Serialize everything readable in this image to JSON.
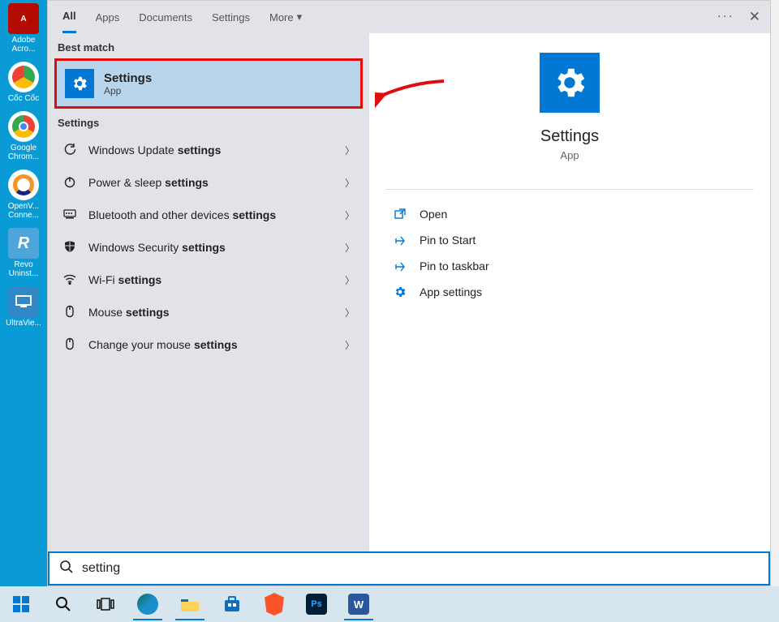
{
  "tabs": {
    "all": "All",
    "apps": "Apps",
    "documents": "Documents",
    "settings": "Settings",
    "more": "More"
  },
  "sections": {
    "best_match": "Best match",
    "settings": "Settings"
  },
  "best_match": {
    "title": "Settings",
    "subtitle": "App"
  },
  "settings_list": [
    {
      "icon": "refresh",
      "text_pre": "Windows Update ",
      "text_bold": "settings"
    },
    {
      "icon": "power",
      "text_pre": "Power & sleep ",
      "text_bold": "settings"
    },
    {
      "icon": "bt",
      "text_pre": "Bluetooth and other devices ",
      "text_bold": "settings"
    },
    {
      "icon": "shield",
      "text_pre": "Windows Security ",
      "text_bold": "settings"
    },
    {
      "icon": "wifi",
      "text_pre": "Wi-Fi ",
      "text_bold": "settings"
    },
    {
      "icon": "mouse",
      "text_pre": "Mouse ",
      "text_bold": "settings"
    },
    {
      "icon": "mouse",
      "text_pre": "Change your mouse ",
      "text_bold": "settings"
    }
  ],
  "preview": {
    "title": "Settings",
    "subtitle": "App"
  },
  "actions": {
    "open": "Open",
    "pin_start": "Pin to Start",
    "pin_taskbar": "Pin to taskbar",
    "app_settings": "App settings"
  },
  "search": {
    "value": "setting"
  },
  "desktop": {
    "items": [
      {
        "id": "adobe",
        "label": "Adobe Acro..."
      },
      {
        "id": "coccoc",
        "label": "Cốc Cốc"
      },
      {
        "id": "chrome",
        "label": "Google Chrom..."
      },
      {
        "id": "openvpn",
        "label": "OpenV... Conne..."
      },
      {
        "id": "revo",
        "label": "Revo Uninst..."
      },
      {
        "id": "ultra",
        "label": "UltraVie..."
      }
    ]
  },
  "taskbar_icons": {
    "ps": "Ps",
    "word": "W"
  }
}
